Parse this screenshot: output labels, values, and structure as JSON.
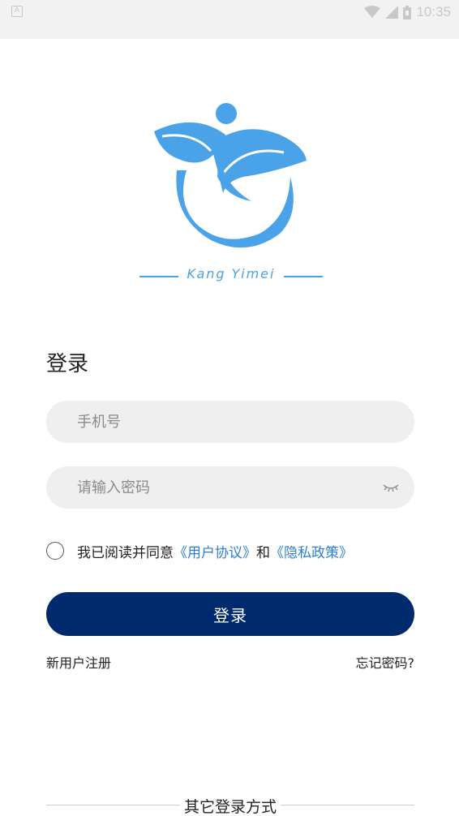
{
  "status_bar": {
    "left_icon_letter": "A",
    "time": "10:35",
    "icons": [
      "wifi-icon",
      "signal-icon",
      "battery-icon"
    ]
  },
  "brand": {
    "logo_text": "Kang Yimei",
    "color": "#4aa3e8"
  },
  "login": {
    "title": "登录",
    "phone_placeholder": "手机号",
    "password_placeholder": "请输入密码",
    "agree_prefix": "我已阅读并同意",
    "user_agreement": "《用户协议》",
    "and": "和",
    "privacy_policy": "《隐私政策》",
    "submit_label": "登录",
    "register_label": "新用户注册",
    "forgot_label": "忘记密码?",
    "other_methods_label": "其它登录方式"
  },
  "colors": {
    "primary_button": "#002a6e",
    "link": "#2d7fd6",
    "field_bg": "#efefef"
  }
}
